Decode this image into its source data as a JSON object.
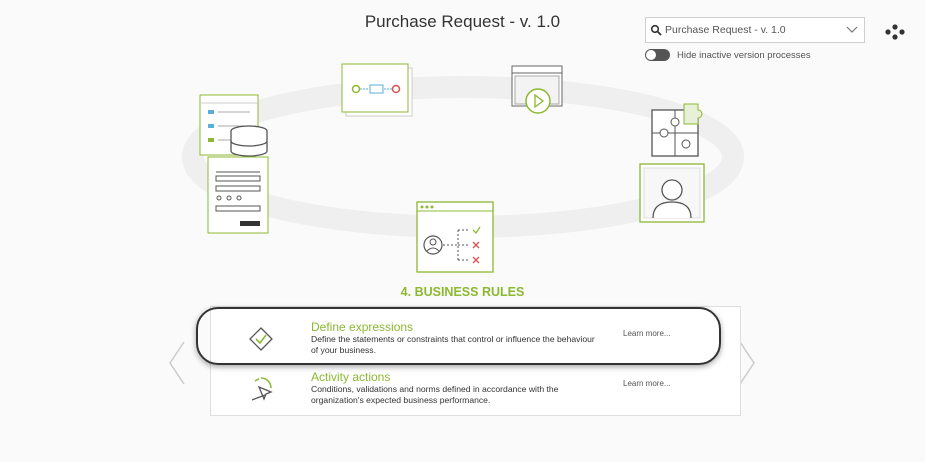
{
  "page": {
    "title": "Purchase Request - v. 1.0"
  },
  "version_select": {
    "value": "Purchase Request - v. 1.0",
    "icon": "search-icon"
  },
  "toggle": {
    "label": "Hide inactive version processes",
    "on": false
  },
  "step": {
    "title": "4. BUSINESS RULES"
  },
  "options": [
    {
      "name": "Define expressions",
      "description_lines": [
        "Define the statements or constraints that control or influence the behaviour",
        "of your business."
      ],
      "learn_more": "Learn more...",
      "icon": "diamond-check-icon",
      "highlighted": true
    },
    {
      "name": "Activity actions",
      "description_lines": [
        "Conditions, validations and norms defined in accordance with the",
        "organization's expected business performance."
      ],
      "learn_more": "Learn more...",
      "icon": "cursor-click-icon",
      "highlighted": false
    }
  ],
  "colors": {
    "accent": "#8cb832",
    "text": "#333333",
    "orbit": "#eeeeee"
  }
}
